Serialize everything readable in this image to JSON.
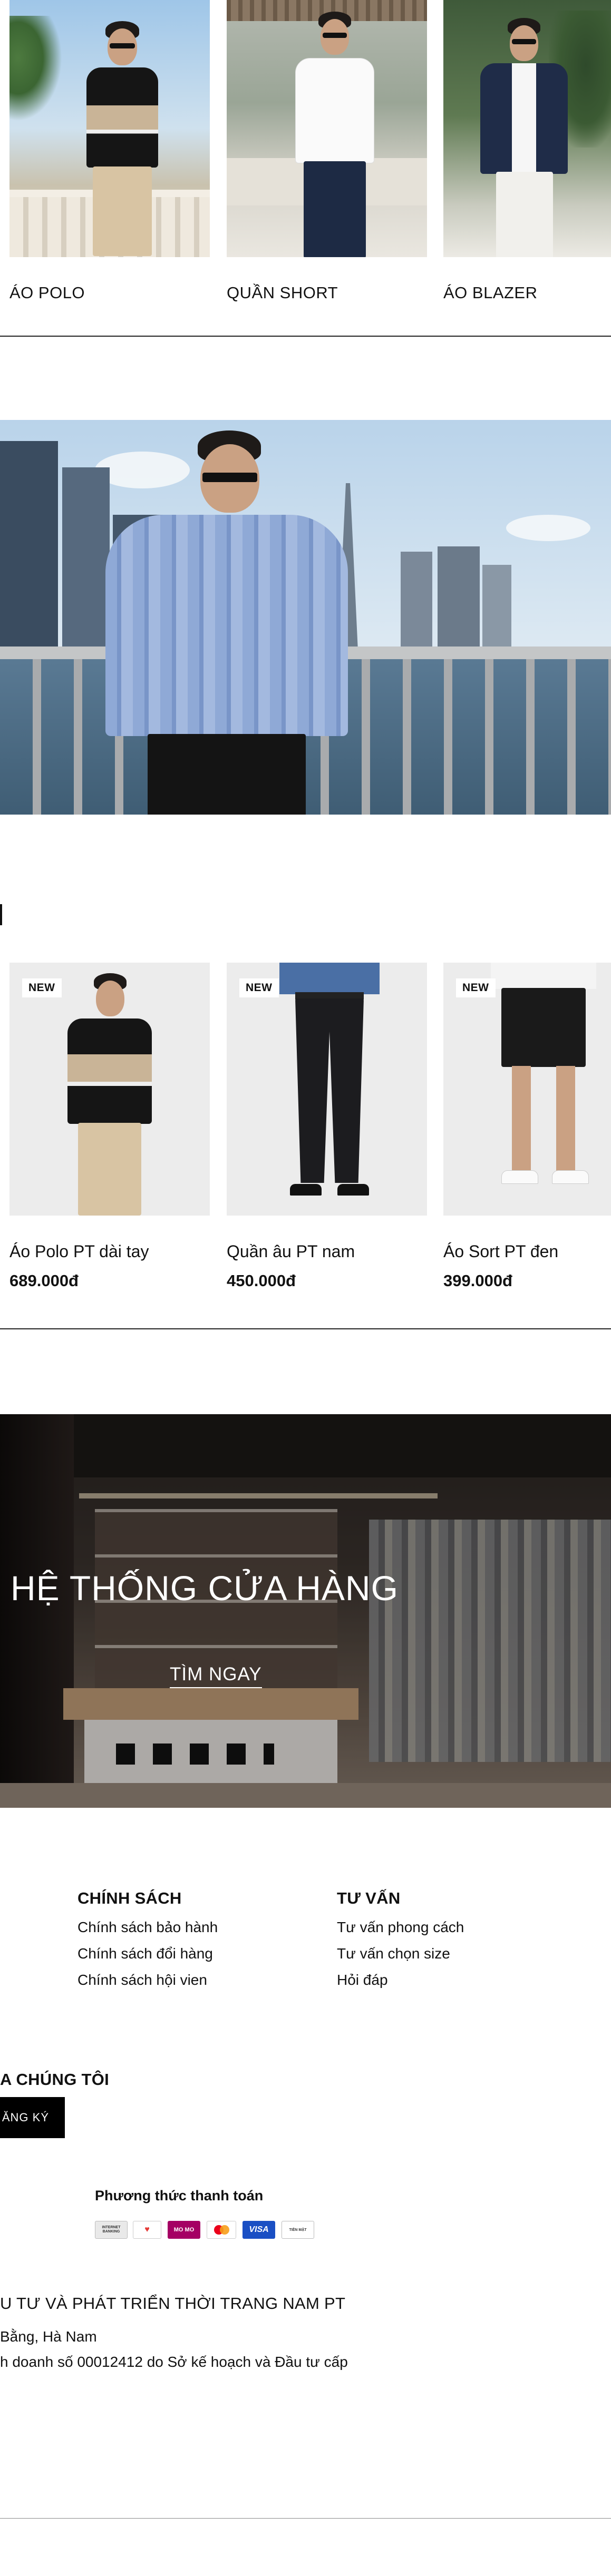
{
  "categories": [
    {
      "label": "ÁO POLO"
    },
    {
      "label": "QUẦN SHORT"
    },
    {
      "label": "ÁO BLAZER"
    }
  ],
  "products": [
    {
      "badge": "NEW",
      "name": "Áo Polo PT dài tay",
      "price": "689.000đ"
    },
    {
      "badge": "NEW",
      "name": "Quần âu PT nam",
      "price": "450.000đ"
    },
    {
      "badge": "NEW",
      "name": "Áo Sort PT đen",
      "price": "399.000đ"
    }
  ],
  "store_banner": {
    "title": "HỆ THỐNG CỬA HÀNG",
    "cta": "TÌM NGAY"
  },
  "footer": {
    "policy": {
      "heading": "CHÍNH SÁCH",
      "links": [
        "Chính sách bảo hành",
        "Chính sách đổi hàng",
        "Chính sách hội vien"
      ]
    },
    "advice": {
      "heading": "TƯ VẤN",
      "links": [
        "Tư vấn phong cách",
        "Tư vấn chọn size",
        "Hỏi đáp"
      ]
    },
    "newsletter": {
      "heading": "A CHÚNG TÔI",
      "button": "ĂNG KÝ"
    },
    "payment": {
      "heading": "Phương thức thanh toán",
      "icons": [
        "internet-banking",
        "vnpay",
        "momo",
        "mastercard",
        "visa",
        "cash"
      ],
      "labels": [
        "INTERNET BANKING",
        "VNPAY",
        "MO MO",
        "",
        "VISA",
        "TIỀN MẶT"
      ]
    },
    "company": {
      "name": "U TƯ VÀ PHÁT TRIỂN THỜI TRANG NAM PT",
      "address": "Bằng, Hà Nam",
      "license": "h doanh số 00012412 do Sở kế hoạch và Đầu tư  cấp"
    }
  },
  "colors": {
    "text": "#111111",
    "button": "#000000",
    "divider": "#222222",
    "product_bg": "#ececec"
  }
}
